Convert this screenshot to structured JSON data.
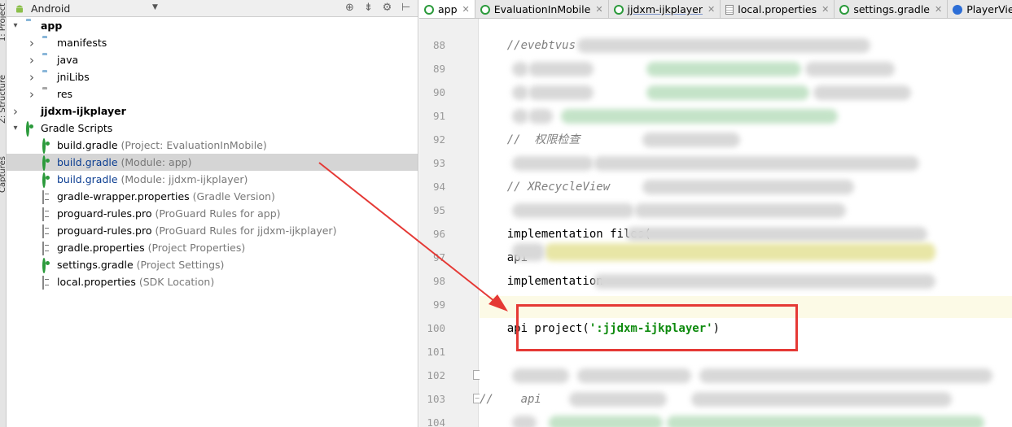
{
  "toolstrip": {
    "tab_project": "1: Project",
    "tab_structure": "Z: Structure",
    "tab_captures": "Captures"
  },
  "project_panel": {
    "view_mode": "Android",
    "tree": [
      {
        "label": "app",
        "hint": "",
        "type": "module",
        "depth": 0,
        "bold": true,
        "expanded": true
      },
      {
        "label": "manifests",
        "hint": "",
        "type": "folder",
        "depth": 1,
        "expanded": false
      },
      {
        "label": "java",
        "hint": "",
        "type": "folder",
        "depth": 1,
        "expanded": false
      },
      {
        "label": "jniLibs",
        "hint": "",
        "type": "folder",
        "depth": 1,
        "expanded": false
      },
      {
        "label": "res",
        "hint": "",
        "type": "folder-res",
        "depth": 1,
        "expanded": false
      },
      {
        "label": "jjdxm-ijkplayer",
        "hint": "",
        "type": "module-lib",
        "depth": 0,
        "bold": true,
        "expanded": false
      },
      {
        "label": "Gradle Scripts",
        "hint": "",
        "type": "gradle",
        "depth": 0,
        "expanded": true
      },
      {
        "label": "build.gradle",
        "hint": "(Project: EvaluationInMobile)",
        "type": "gradle",
        "depth": 1
      },
      {
        "label": "build.gradle",
        "hint": "(Module: app)",
        "type": "gradle",
        "depth": 1,
        "selected": true
      },
      {
        "label": "build.gradle",
        "hint": "(Module: jjdxm-ijkplayer)",
        "type": "gradle",
        "depth": 1,
        "blue": true
      },
      {
        "label": "gradle-wrapper.properties",
        "hint": "(Gradle Version)",
        "type": "props",
        "depth": 1
      },
      {
        "label": "proguard-rules.pro",
        "hint": "(ProGuard Rules for app)",
        "type": "props",
        "depth": 1
      },
      {
        "label": "proguard-rules.pro",
        "hint": "(ProGuard Rules for jjdxm-ijkplayer)",
        "type": "props",
        "depth": 1
      },
      {
        "label": "gradle.properties",
        "hint": "(Project Properties)",
        "type": "props",
        "depth": 1
      },
      {
        "label": "settings.gradle",
        "hint": "(Project Settings)",
        "type": "gradle",
        "depth": 1
      },
      {
        "label": "local.properties",
        "hint": "(SDK Location)",
        "type": "props",
        "depth": 1
      }
    ]
  },
  "tabs": [
    {
      "label": "app",
      "icon": "gradle",
      "active": true
    },
    {
      "label": "EvaluationInMobile",
      "icon": "gradle"
    },
    {
      "label": "jjdxm-ijkplayer",
      "icon": "gradle",
      "underline": true
    },
    {
      "label": "local.properties",
      "icon": "props"
    },
    {
      "label": "settings.gradle",
      "icon": "gradle"
    },
    {
      "label": "PlayerView",
      "icon": "class"
    }
  ],
  "editor": {
    "lines": [
      {
        "num": "88",
        "text": "    //evebtvus",
        "style": "comment"
      },
      {
        "num": "89",
        "text": "",
        "style": "blurred"
      },
      {
        "num": "90",
        "text": "",
        "style": "blurred"
      },
      {
        "num": "91",
        "text": "",
        "style": "blurred"
      },
      {
        "num": "92",
        "text": "    //  权限检查",
        "style": "comment"
      },
      {
        "num": "93",
        "text": "",
        "style": "blurred"
      },
      {
        "num": "94",
        "text": "    // XRecycleView",
        "style": "comment"
      },
      {
        "num": "95",
        "text": "",
        "style": "blurred"
      },
      {
        "num": "96",
        "text": "    implementation files(",
        "style": "plain"
      },
      {
        "num": "97",
        "text": "    api",
        "style": "plain"
      },
      {
        "num": "98",
        "text": "    implementation",
        "style": "plain"
      },
      {
        "num": "99",
        "text": "",
        "style": "current"
      },
      {
        "num": "100",
        "text": "    api project(':jjdxm-ijkplayer')",
        "style": "project"
      },
      {
        "num": "101",
        "text": "",
        "style": "empty"
      },
      {
        "num": "102",
        "text": "",
        "style": "blurred"
      },
      {
        "num": "103",
        "text": "//    api",
        "style": "comment"
      },
      {
        "num": "104",
        "text": "",
        "style": "blurred"
      }
    ],
    "code_100": {
      "prefix": "    api project(",
      "string": "':jjdxm-ijkplayer'",
      "suffix": ")"
    }
  },
  "colors": {
    "annotation": "#e53935",
    "string": "#0d8a0d",
    "comment": "#808080",
    "selection": "#d5d5d5"
  }
}
